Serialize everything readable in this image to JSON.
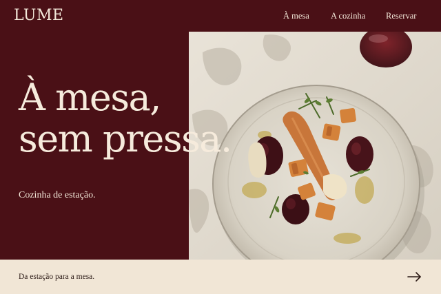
{
  "brand": {
    "logo": "LUME"
  },
  "nav": {
    "links": [
      {
        "label": "À mesa"
      },
      {
        "label": "A cozinha"
      },
      {
        "label": "Reservar"
      }
    ]
  },
  "hero": {
    "headline_line1": "À mesa,",
    "headline_line2": "sem pressa.",
    "subtitle": "Cozinha de estação."
  },
  "footer": {
    "text": "Da estação para a mesa.",
    "arrow_icon": "arrow-right-icon"
  },
  "colors": {
    "burgundy": "#4a1016",
    "cream": "#f1e6d6",
    "text_light": "#f3e8d9",
    "text_dark": "#2b1a16"
  }
}
